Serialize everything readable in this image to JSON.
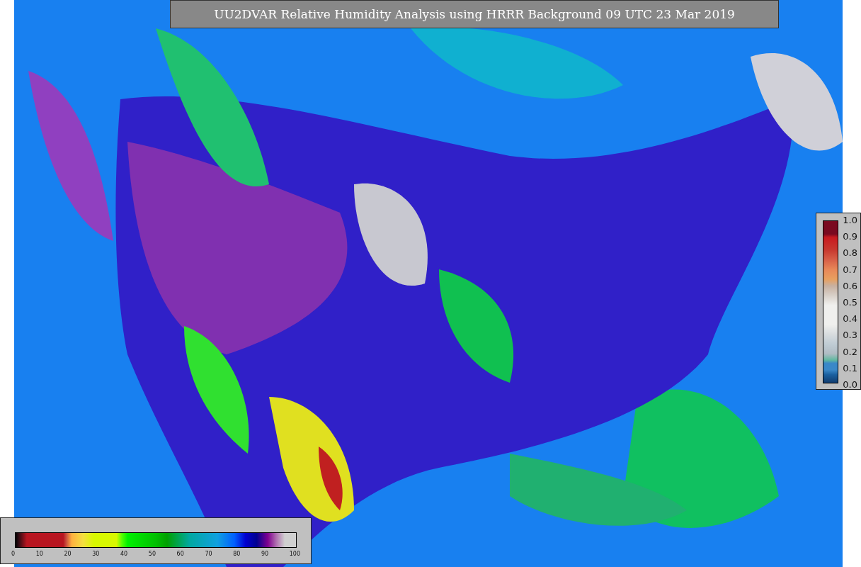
{
  "title": "UU2DVAR Relative Humidity Analysis using HRRR Background 09 UTC 23 Mar 2019",
  "humidity_colorbar": {
    "ticks": [
      "0",
      "10",
      "20",
      "30",
      "40",
      "50",
      "60",
      "70",
      "80",
      "90",
      "100"
    ]
  },
  "station_colorbar": {
    "ticks": [
      "1.0",
      "0.9",
      "0.8",
      "0.7",
      "0.6",
      "0.5",
      "0.4",
      "0.3",
      "0.2",
      "0.1",
      "0.0"
    ]
  }
}
